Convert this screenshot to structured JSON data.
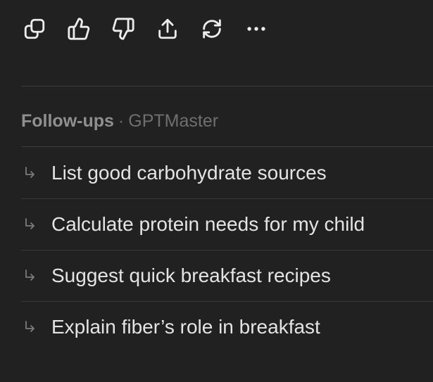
{
  "toolbar": {
    "buttons": [
      {
        "name": "copy",
        "icon": "copy-icon"
      },
      {
        "name": "thumbs-up",
        "icon": "thumbs-up-icon"
      },
      {
        "name": "thumbs-down",
        "icon": "thumbs-down-icon"
      },
      {
        "name": "share",
        "icon": "share-icon"
      },
      {
        "name": "regenerate",
        "icon": "refresh-icon"
      },
      {
        "name": "more",
        "icon": "more-icon"
      }
    ]
  },
  "followups": {
    "title": "Follow-ups",
    "separator": "·",
    "source": "GPTMaster",
    "items": [
      {
        "label": "List good carbohydrate sources"
      },
      {
        "label": "Calculate protein needs for my child"
      },
      {
        "label": "Suggest quick breakfast recipes"
      },
      {
        "label": "Explain fiber’s role in breakfast"
      }
    ]
  },
  "colors": {
    "background": "#212121",
    "icon": "#ececec",
    "text": "#e4e4e4",
    "muted": "#8f8f8f",
    "divider": "#3a3a3a"
  }
}
